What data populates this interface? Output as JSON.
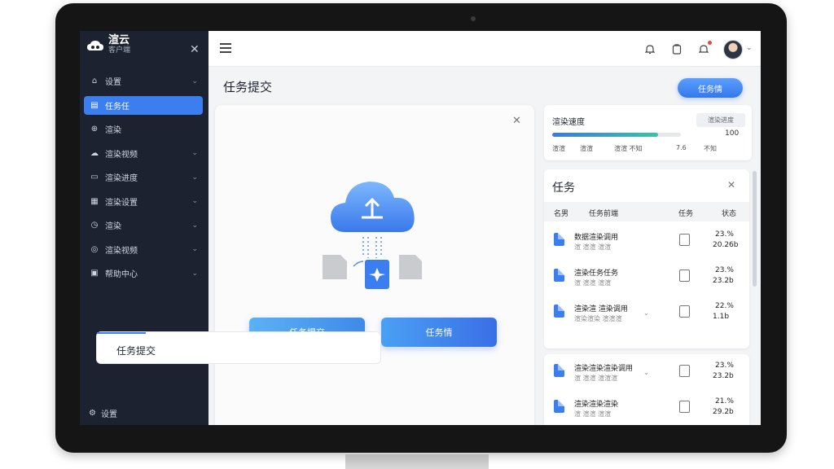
{
  "app": {
    "name": "渲云",
    "subtitle": "客户端"
  },
  "sidebar": {
    "close_icon": "close-icon",
    "items": [
      {
        "label": "设置",
        "icon": "home-icon",
        "has_chevron": true,
        "active": false
      },
      {
        "label": "任务任",
        "icon": "task-icon",
        "has_chevron": false,
        "active": true
      },
      {
        "label": "渲染",
        "icon": "globe-icon",
        "has_chevron": false,
        "active": false
      },
      {
        "label": "渲染视频",
        "icon": "cloud-icon",
        "has_chevron": true,
        "active": false
      },
      {
        "label": "渲染进度",
        "icon": "folder-icon",
        "has_chevron": true,
        "active": false
      },
      {
        "label": "渲染设置",
        "icon": "grid-icon",
        "has_chevron": true,
        "active": false
      },
      {
        "label": "渲染",
        "icon": "clock-icon",
        "has_chevron": true,
        "active": false
      },
      {
        "label": "渲染视频",
        "icon": "chart-icon",
        "has_chevron": true,
        "active": false
      },
      {
        "label": "帮助中心",
        "icon": "doc-icon",
        "has_chevron": true,
        "active": false
      }
    ],
    "footer_label": "设置"
  },
  "topbar": {
    "menu_icon": "hamburger-icon",
    "icons": [
      "bell-icon",
      "clipboard-icon",
      "notification-icon"
    ]
  },
  "page": {
    "title": "任务提交",
    "primary_button": "任务情"
  },
  "upload": {
    "button_one": "任务提交",
    "button_two": "任务情",
    "subcard_title": "任务提交"
  },
  "progress": {
    "title": "渲染速度",
    "tag": "渲染进度",
    "max_value": "100",
    "fill_fraction": 0.82,
    "labels": [
      "渲渲",
      "渲渲",
      "渲渲 不知",
      "7.6",
      "不知"
    ],
    "accent_start": "#3a78ea",
    "accent_end": "#35c7a0"
  },
  "tasks": {
    "title": "任务",
    "columns": [
      "名男",
      "任务前端",
      "任务",
      "状态"
    ],
    "rows": [
      {
        "name": "数据渲染调用",
        "sub": "渲 渲渲 渲渲",
        "pct": "23.%",
        "size": "20.26b"
      },
      {
        "name": "渲染任务任务",
        "sub": "渲 渲渲 渲渲",
        "pct": "23.%",
        "size": "23.2b"
      },
      {
        "name": "渲染渲 渲染调用",
        "sub": "渲染渲染 渲渲渲",
        "pct": "22.%",
        "size": "1.1b"
      }
    ],
    "rows2": [
      {
        "name": "渲染渲染渲染调用",
        "sub": "渲 渲渲 渲渲渲",
        "pct": "23.%",
        "size": "23.2b"
      },
      {
        "name": "渲染渲染渲染",
        "sub": "渲 渲渲 渲渲",
        "pct": "21.%",
        "size": "29.2b"
      }
    ]
  },
  "colors": {
    "sidebar_bg": "#1c2230",
    "accent": "#3b7ef0"
  }
}
